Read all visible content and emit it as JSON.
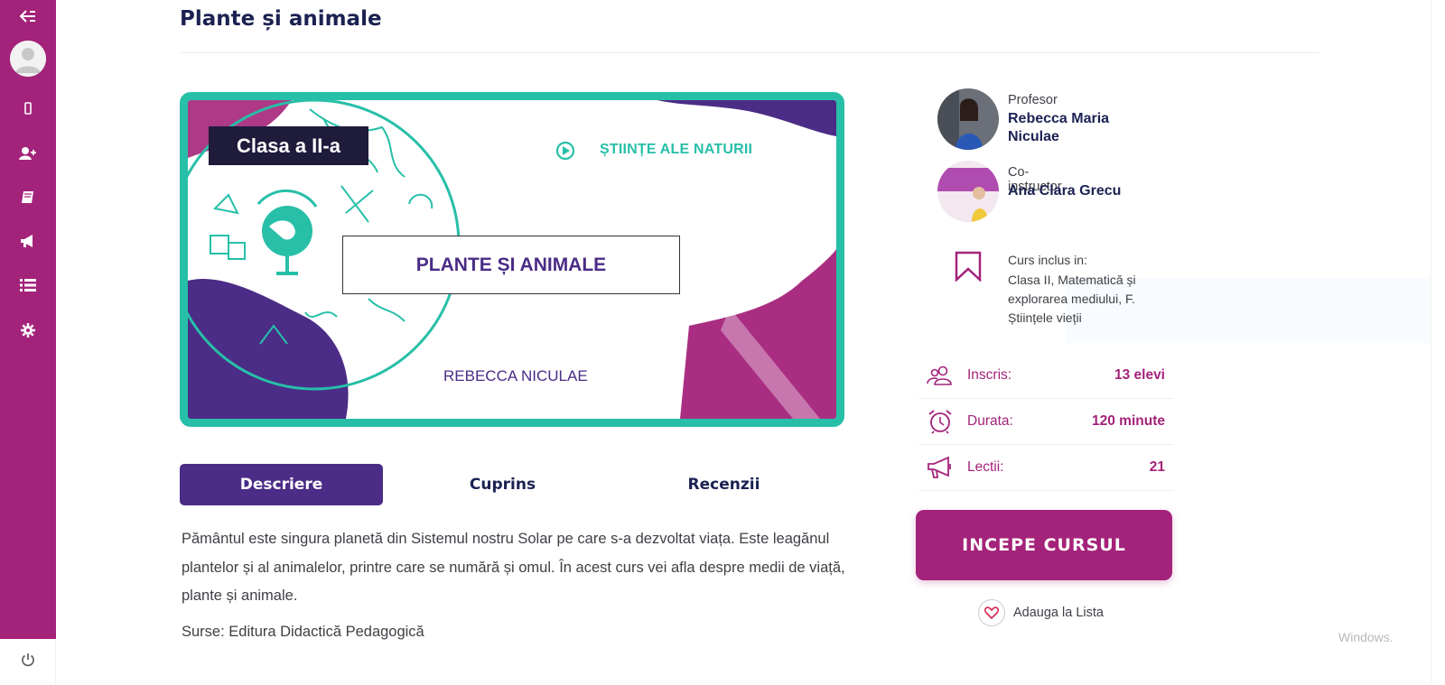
{
  "page": {
    "title": "Plante și animale"
  },
  "sidebar": {
    "icons": [
      "collapse-arrow-icon",
      "user-avatar",
      "mobile-icon",
      "add-user-icon",
      "book-icon",
      "megaphone-icon",
      "list-icon",
      "gear-icon",
      "power-icon"
    ]
  },
  "banner": {
    "grade": "Clasa a II-a",
    "subject": "ȘTIINȚE ALE NATURII",
    "course_title": "PLANTE ȘI ANIMALE",
    "author": "REBECCA NICULAE"
  },
  "tabs": [
    {
      "label": "Descriere",
      "active": true
    },
    {
      "label": "Cuprins",
      "active": false
    },
    {
      "label": "Recenzii",
      "active": false
    }
  ],
  "description": {
    "text": "Pământul este singura planetă din Sistemul nostru Solar pe care s-a dezvoltat viața. Este leagănul plantelor și al animalelor, printre care se numără și omul. În acest curs vei afla despre medii de viață, plante și animale.",
    "sources": "Surse: Editura Didactică Pedagogică"
  },
  "instructors": [
    {
      "role": "Profesor",
      "name": "Rebecca Maria Niculae"
    },
    {
      "role": "Co-instructor",
      "name": "Ana Clara Grecu"
    }
  ],
  "bundle": {
    "label": "Curs inclus in:",
    "links": [
      "Clasa II",
      "Matematică și explorarea mediului",
      "F. Științele vieții"
    ]
  },
  "stats": [
    {
      "icon": "users-icon",
      "label": "Inscris:",
      "value": "13 elevi"
    },
    {
      "icon": "alarm-clock-icon",
      "label": "Durata:",
      "value": "120 minute"
    },
    {
      "icon": "megaphone-icon",
      "label": "Lectii:",
      "value": "21"
    }
  ],
  "actions": {
    "start": "INCEPE CURSUL",
    "wishlist": "Adauga la Lista"
  },
  "watermark": "Windows.",
  "colors": {
    "brand_magenta": "#a4237a",
    "brand_purple": "#4b2c86",
    "navy": "#1b2252",
    "teal": "#27bfa8"
  }
}
